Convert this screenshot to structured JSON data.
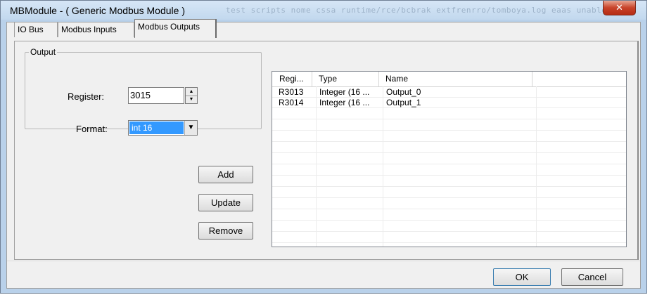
{
  "window": {
    "title": "MBModule - ( Generic Modbus Module )",
    "background_text": "test scripts nome cssa runtime/rce/bcbrak extfrenrro/tomboya.log eaas unable to the"
  },
  "tabs": [
    {
      "label": "IO Bus",
      "active": false
    },
    {
      "label": "Modbus Inputs",
      "active": false
    },
    {
      "label": "Modbus Outputs",
      "active": true
    }
  ],
  "output_group": {
    "legend": "Output",
    "register_label": "Register:",
    "register_value": "3015",
    "format_label": "Format:",
    "format_value": "int 16"
  },
  "buttons": {
    "add": "Add",
    "update": "Update",
    "remove": "Remove",
    "ok": "OK",
    "cancel": "Cancel"
  },
  "list": {
    "columns": [
      "Regi...",
      "Type",
      "Name"
    ],
    "rows": [
      [
        "R3013",
        "Integer (16 ...",
        "Output_0"
      ],
      [
        "R3014",
        "Integer (16 ...",
        "Output_1"
      ]
    ]
  },
  "colors": {
    "selection": "#3399ff",
    "close_button": "#c8432a",
    "window_frame": "#b9d1ea"
  }
}
